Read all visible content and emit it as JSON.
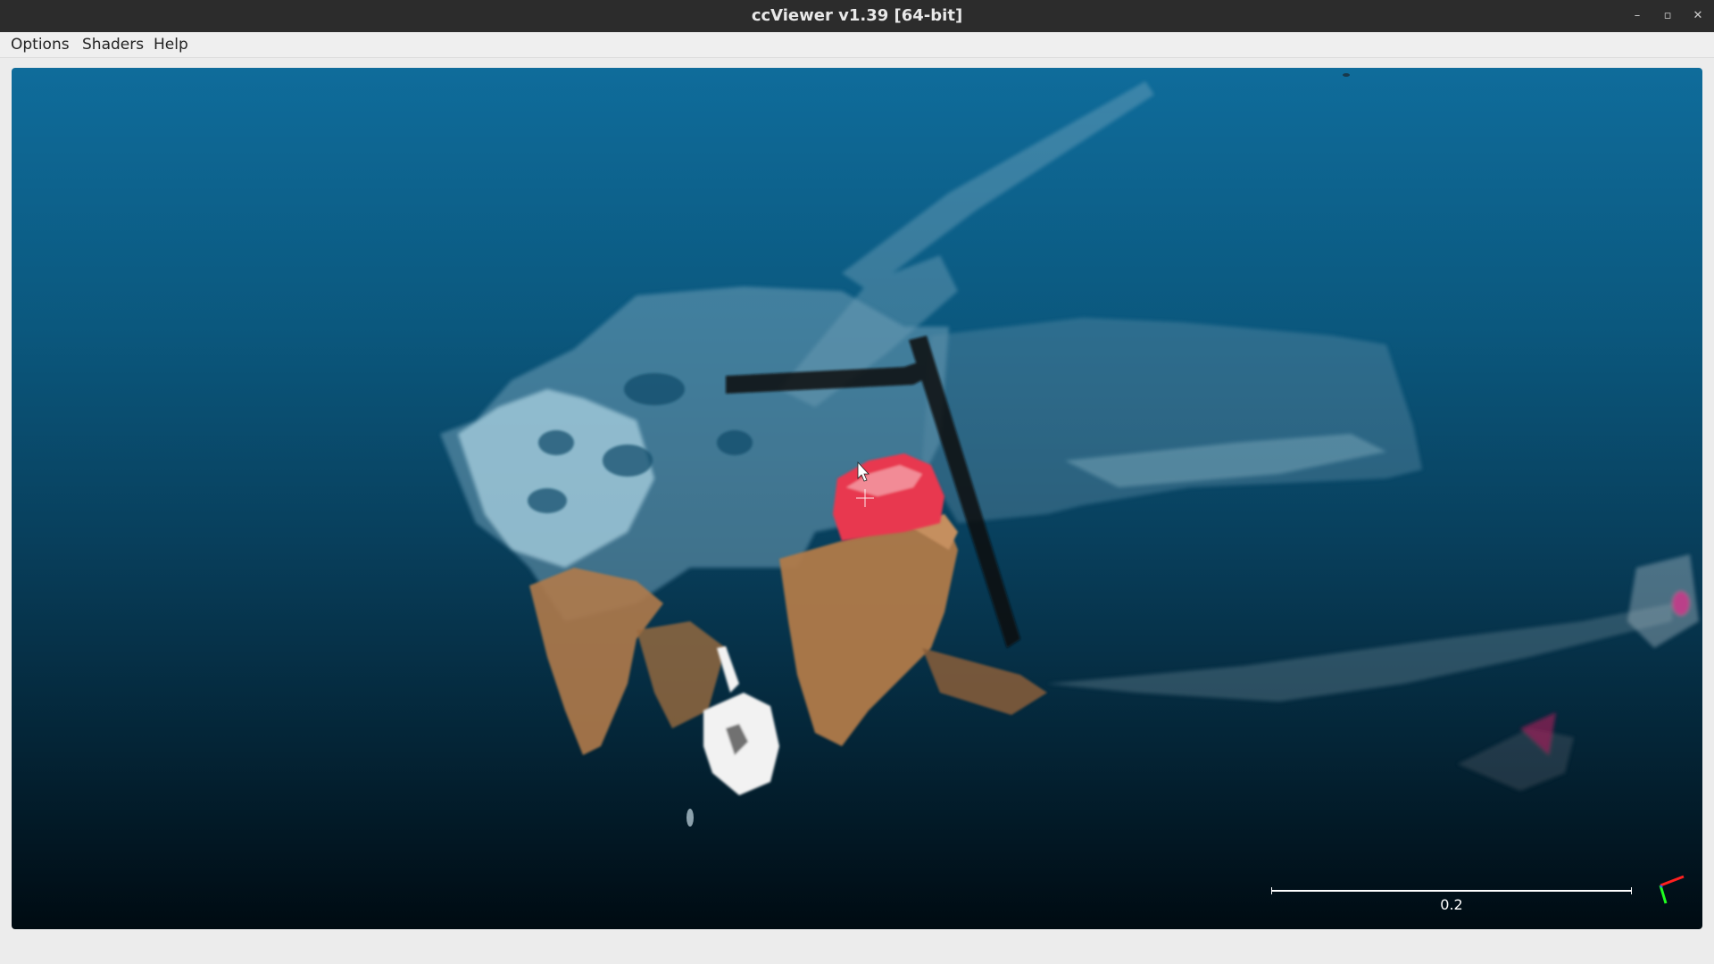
{
  "window": {
    "title": "ccViewer v1.39 [64-bit]",
    "controls": {
      "minimize": "–",
      "maximize": "▫",
      "close": "✕"
    }
  },
  "menu": {
    "items": [
      {
        "label": "Options"
      },
      {
        "label": "Shaders"
      },
      {
        "label": "Help"
      }
    ]
  },
  "viewer": {
    "scale_label": "0.2",
    "background_colors": {
      "top": "#0f6c9b",
      "bottom": "#000b12"
    },
    "axis_colors": {
      "x": "#ff2020",
      "y": "#20ff20",
      "z": "#2060ff"
    },
    "cloud_colors": {
      "wall": "#9fc7da",
      "wood": "#b07a4a",
      "red_object": "#e8384f",
      "white_object": "#f2f2f2",
      "dark_edge": "#111111"
    }
  }
}
